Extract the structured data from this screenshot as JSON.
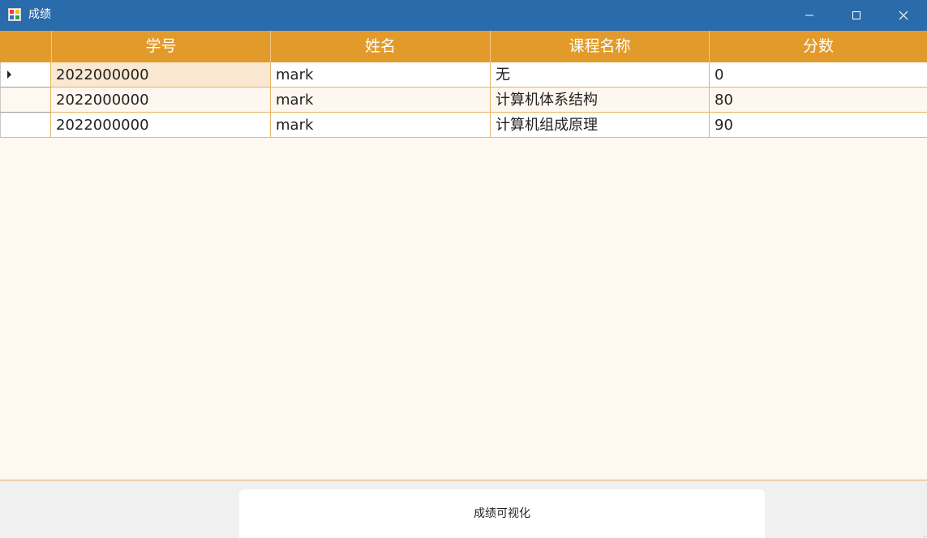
{
  "window": {
    "title": "成绩",
    "icon": "app-window-icon",
    "accent": "#2a6bab"
  },
  "grid": {
    "header_color": "#e29b2a",
    "columns": [
      "学号",
      "姓名",
      "课程名称",
      "分数"
    ],
    "rows": [
      {
        "cells": [
          "2022000000",
          "mark",
          "无",
          "0"
        ],
        "current": true
      },
      {
        "cells": [
          "2022000000",
          "mark",
          "计算机体系结构",
          "80"
        ],
        "current": false
      },
      {
        "cells": [
          "2022000000",
          "mark",
          "计算机组成原理",
          "90"
        ],
        "current": false
      }
    ]
  },
  "actions": {
    "visualize_label": "成绩可视化"
  }
}
